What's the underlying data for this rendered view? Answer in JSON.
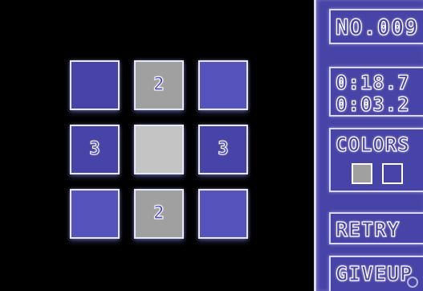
{
  "level": {
    "label": "NO.009"
  },
  "timers": {
    "total": "0:18.7",
    "current": "0:03.2"
  },
  "colors": {
    "label": "COLORS",
    "swatches": [
      {
        "name": "gray",
        "color": "#a0a0a0"
      },
      {
        "name": "blue",
        "color": "#4843a6"
      }
    ]
  },
  "buttons": {
    "retry": "RETRY",
    "giveup": "GIVEUP"
  },
  "palette": {
    "blue": "#4843a6",
    "light_blue": "#5753bc",
    "gray": "#a0a0a0",
    "light_gray": "#c4c4c4",
    "border": "#e8e8f4"
  },
  "grid": {
    "rows": 3,
    "cols": 3,
    "cells": [
      {
        "row": 0,
        "col": 0,
        "color": "blue",
        "number": ""
      },
      {
        "row": 0,
        "col": 1,
        "color": "gray",
        "number": "2"
      },
      {
        "row": 0,
        "col": 2,
        "color": "light_blue",
        "number": ""
      },
      {
        "row": 1,
        "col": 0,
        "color": "blue",
        "number": "3"
      },
      {
        "row": 1,
        "col": 1,
        "color": "light_gray",
        "number": ""
      },
      {
        "row": 1,
        "col": 2,
        "color": "blue",
        "number": "3"
      },
      {
        "row": 2,
        "col": 0,
        "color": "light_blue",
        "number": ""
      },
      {
        "row": 2,
        "col": 1,
        "color": "gray",
        "number": "2"
      },
      {
        "row": 2,
        "col": 2,
        "color": "light_blue",
        "number": ""
      }
    ]
  }
}
